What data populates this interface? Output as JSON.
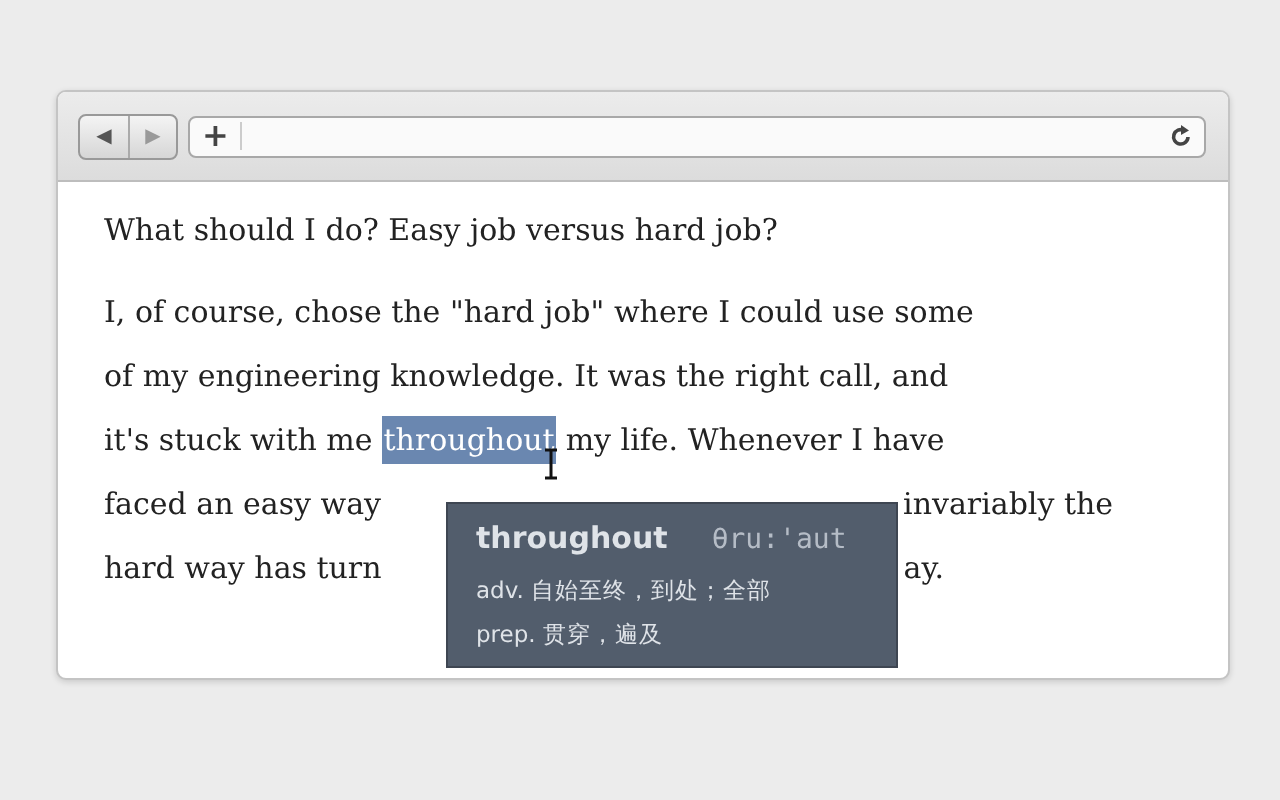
{
  "toolbar": {
    "back": {
      "glyph": "◀",
      "disabled": false
    },
    "forward": {
      "glyph": "▶",
      "disabled": true
    },
    "add_glyph": "+"
  },
  "heading": "What should I do? Easy job versus hard job?",
  "lines": [
    {
      "segments": [
        {
          "kind": "text",
          "text": "I, of course, chose the \"hard job\" where I could use some"
        }
      ]
    },
    {
      "segments": [
        {
          "kind": "text",
          "text": "of my engineering knowledge. It was the right call, and"
        }
      ]
    },
    {
      "segments": [
        {
          "kind": "text",
          "text": "it's stuck with me"
        },
        {
          "kind": "word",
          "text": "throughout",
          "selected": true
        },
        {
          "kind": "text",
          "text": "my life. Whenever I have"
        }
      ]
    },
    {
      "segments": [
        {
          "kind": "text",
          "text": "faced an easy way"
        },
        {
          "kind": "gap"
        },
        {
          "kind": "text",
          "text": "invariably the"
        }
      ]
    },
    {
      "segments": [
        {
          "kind": "text",
          "text": "hard way has turn"
        },
        {
          "kind": "gap"
        },
        {
          "kind": "text",
          "text": "ay."
        }
      ]
    }
  ],
  "popup": {
    "word": "throughout",
    "phonetic": "θru:'aut",
    "senses": [
      {
        "pos": "adv.",
        "meaning": "自始至终，到处；全部"
      },
      {
        "pos": "prep.",
        "meaning": "贯穿，遍及"
      }
    ]
  }
}
